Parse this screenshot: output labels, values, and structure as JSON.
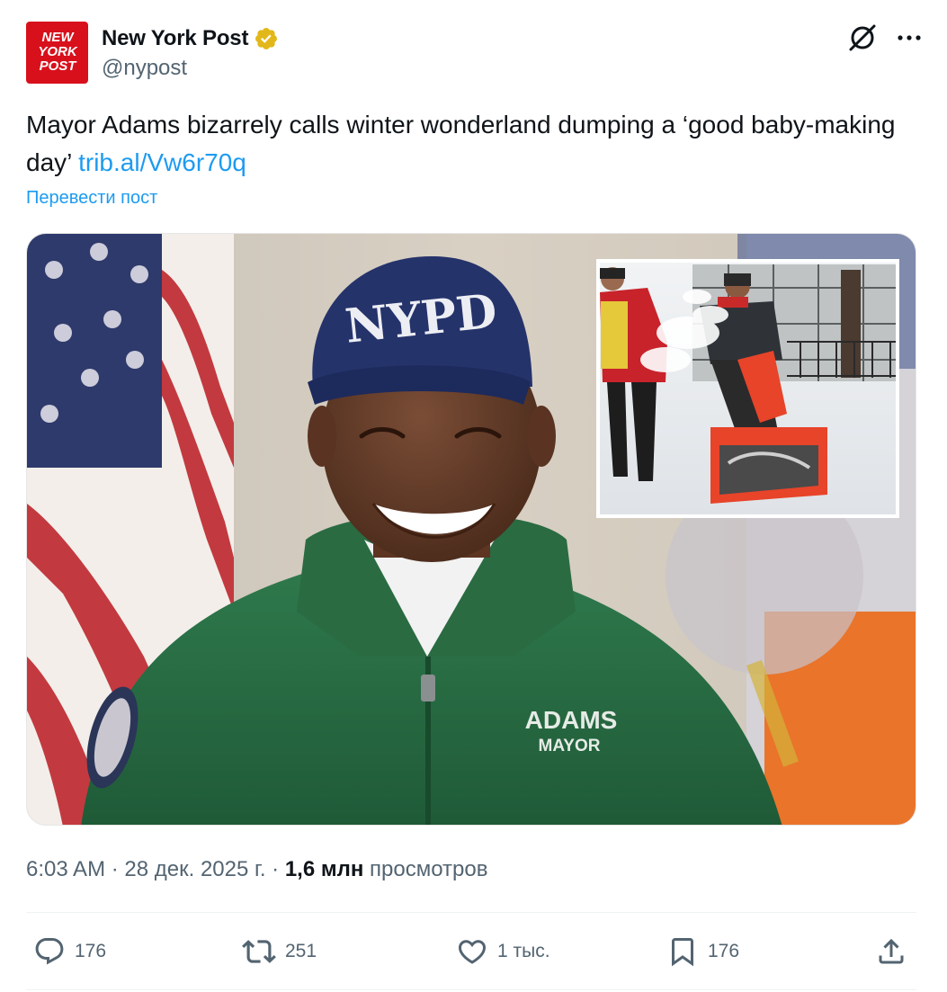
{
  "account": {
    "display_name": "New York Post",
    "handle": "@nypost",
    "logo_lines": [
      "NEW",
      "YORK",
      "POST"
    ],
    "verified_badge_color": "#e2b719",
    "logo_color": "#d8101c"
  },
  "tweet": {
    "text": "Mayor Adams bizarrely calls winter wonderland dumping a ‘good baby-making day’ ",
    "link": "trib.al/Vw6r70q",
    "translate_label": "Перевести пост"
  },
  "media": {
    "cap_text": "NYPD",
    "jacket_name": "ADAMS",
    "jacket_title": "MAYOR"
  },
  "meta": {
    "time": "6:03 AM",
    "sep": " · ",
    "date": "28 дек. 2025 г.",
    "views_count": "1,6 млн",
    "views_label": " просмотров"
  },
  "actions": {
    "replies": "176",
    "reposts": "251",
    "likes": "1 тыс.",
    "bookmarks": "176"
  },
  "icons": {
    "grok": "grok-icon",
    "more": "more-icon",
    "reply": "reply-icon",
    "repost": "repost-icon",
    "like": "heart-icon",
    "bookmark": "bookmark-icon",
    "share": "share-icon"
  },
  "colors": {
    "link": "#1d9bf0",
    "secondary_text": "#536471",
    "primary_text": "#0f1419"
  }
}
